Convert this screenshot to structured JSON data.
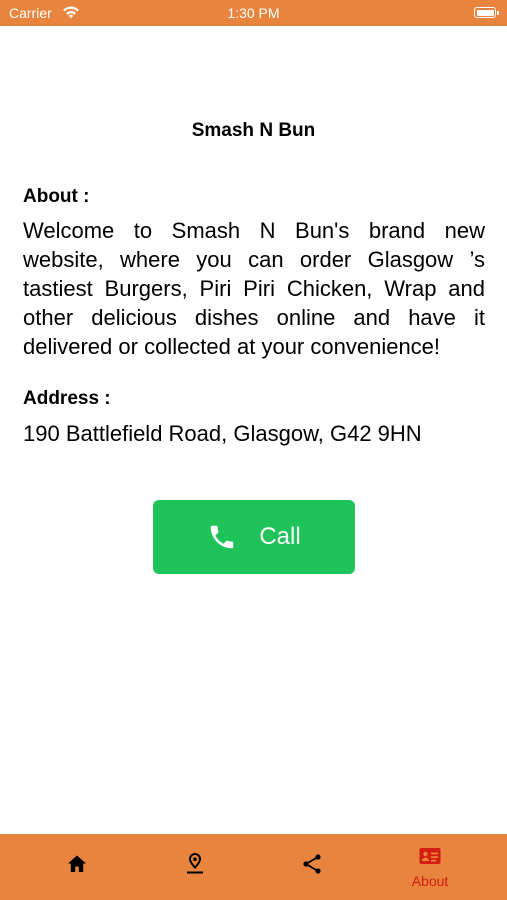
{
  "status_bar": {
    "carrier": "Carrier",
    "time": "1:30 PM"
  },
  "title": "Smash N Bun",
  "about": {
    "label": "About :",
    "text": "Welcome to Smash N Bun's brand new website, where you can order Glasgow ’s tastiest Burgers, Piri Piri Chicken, Wrap and other delicious dishes online and have it delivered or collected at your convenience!"
  },
  "address": {
    "label": "Address :",
    "text": "190 Battlefield Road, Glasgow, G42 9HN"
  },
  "call_button": {
    "label": "Call",
    "icon": "phone-icon"
  },
  "tab_bar": {
    "tabs": [
      {
        "icon": "home-icon",
        "label": ""
      },
      {
        "icon": "location-pin-icon",
        "label": ""
      },
      {
        "icon": "share-icon",
        "label": ""
      },
      {
        "icon": "contact-card-icon",
        "label": "About",
        "active": true
      }
    ]
  },
  "colors": {
    "brand": "#e8843e",
    "call_button": "#1ec45a",
    "active_tab": "#d41e12"
  }
}
